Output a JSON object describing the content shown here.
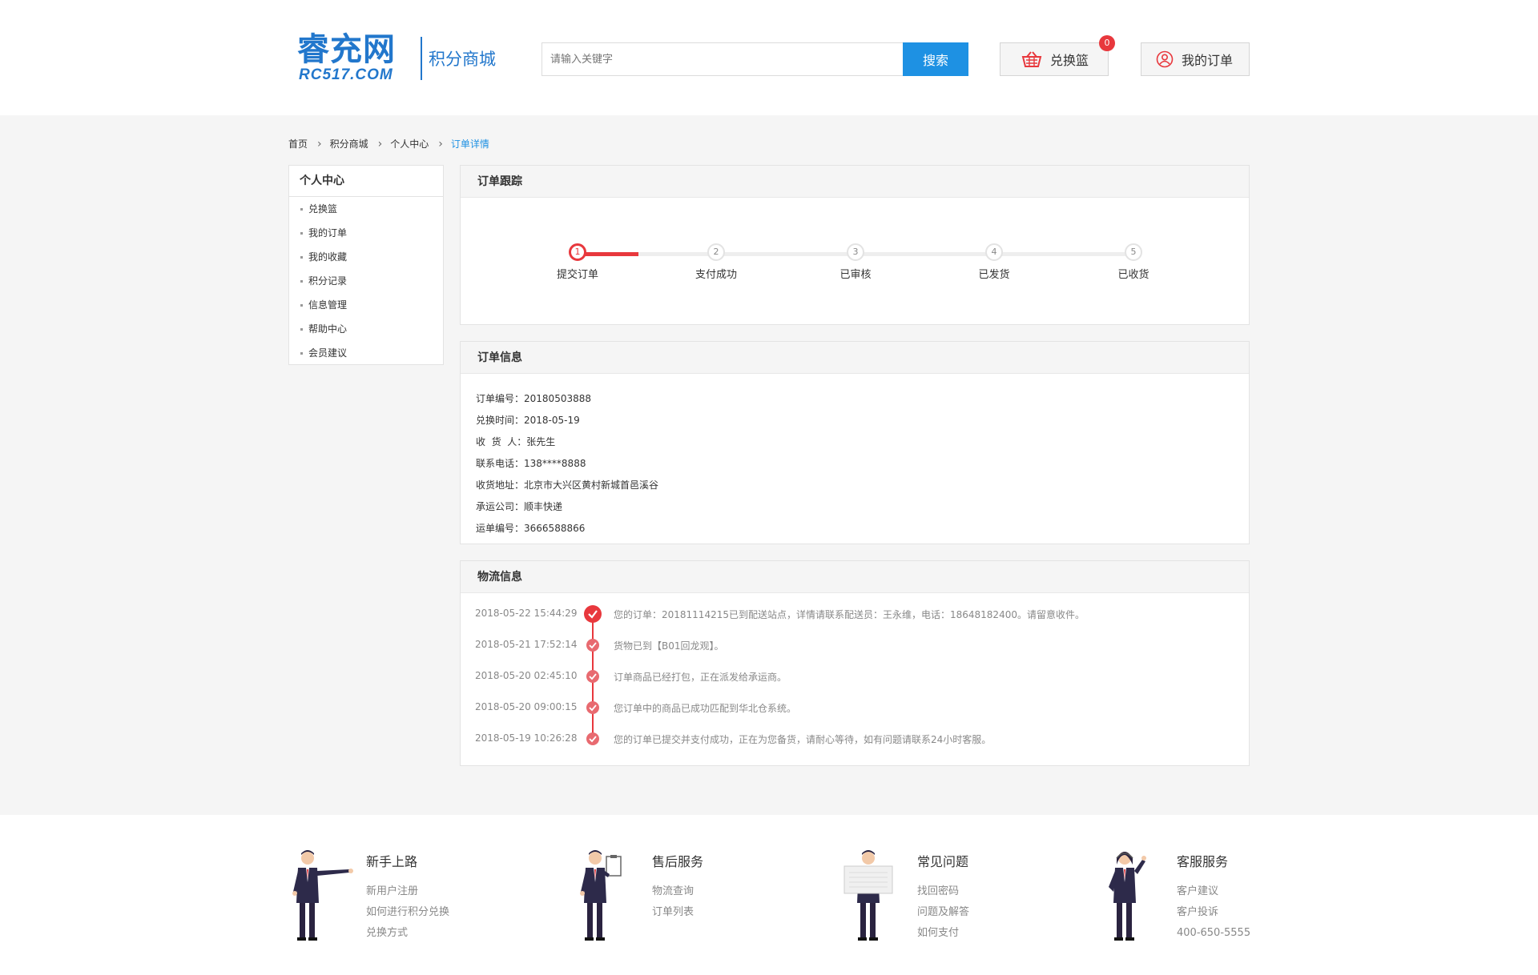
{
  "header": {
    "logo_cn": "睿充网",
    "logo_en": "RC517.COM",
    "logo_sub": "积分商城",
    "search_placeholder": "请输入关键字",
    "search_button": "搜索",
    "cart_label": "兑换篮",
    "cart_count": "0",
    "orders_label": "我的订单"
  },
  "breadcrumb": [
    "首页",
    "积分商城",
    "个人中心",
    "订单详情"
  ],
  "sidebar": {
    "title": "个人中心",
    "items": [
      "兑换篮",
      "我的订单",
      "我的收藏",
      "积分记录",
      "信息管理",
      "帮助中心",
      "会员建议"
    ]
  },
  "tracking": {
    "title": "订单跟踪",
    "progress": 0.11,
    "steps": [
      {
        "num": "1",
        "label": "提交订单"
      },
      {
        "num": "2",
        "label": "支付成功"
      },
      {
        "num": "3",
        "label": "已审核"
      },
      {
        "num": "4",
        "label": "已发货"
      },
      {
        "num": "5",
        "label": "已收货"
      }
    ]
  },
  "order_info": {
    "title": "订单信息",
    "rows": [
      {
        "key": "订单编号：",
        "value": "20180503888"
      },
      {
        "key": "兑换时间：",
        "value": "2018-05-19"
      },
      {
        "key": "收  货  人：",
        "value": "张先生"
      },
      {
        "key": "联系电话：",
        "value": "138****8888"
      },
      {
        "key": "收货地址：",
        "value": "北京市大兴区黄村新城首邑溪谷"
      },
      {
        "key": "承运公司：",
        "value": "顺丰快递"
      },
      {
        "key": "运单编号：",
        "value": "3666588866"
      }
    ]
  },
  "logistics": {
    "title": "物流信息",
    "entries": [
      {
        "time": "2018-05-22 15:44:29",
        "text": "您的订单：20181114215已到配送站点，详情请联系配送员：王永维，电话：18648182400。请留意收件。"
      },
      {
        "time": "2018-05-21 17:52:14",
        "text": "货物已到【B01回龙观】。"
      },
      {
        "time": "2018-05-20 02:45:10",
        "text": "订单商品已经打包，正在派发给承运商。"
      },
      {
        "time": "2018-05-20 09:00:15",
        "text": "您订单中的商品已成功匹配到华北仓系统。"
      },
      {
        "time": "2018-05-19 10:26:28",
        "text": "您的订单已提交并支付成功，正在为您备货，请耐心等待，如有问题请联系24小时客服。"
      }
    ]
  },
  "footer": [
    {
      "title": "新手上路",
      "links": [
        "新用户注册",
        "如何进行积分兑换",
        "兑换方式"
      ]
    },
    {
      "title": "售后服务",
      "links": [
        "物流查询",
        "订单列表"
      ]
    },
    {
      "title": "常见问题",
      "links": [
        "找回密码",
        "问题及解答",
        "如何支付"
      ]
    },
    {
      "title": "客服服务",
      "links": [
        "客户建议",
        "客户投诉",
        "400-650-5555"
      ]
    }
  ],
  "colors": {
    "brand": "#2277cc",
    "accent": "#1e91e3",
    "red": "#e8383d"
  }
}
